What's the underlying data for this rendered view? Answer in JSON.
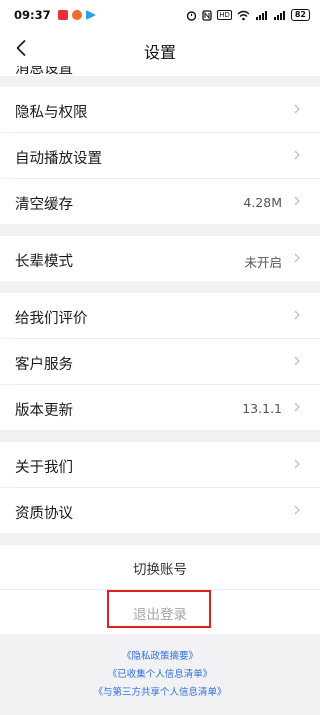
{
  "status_bar": {
    "time": "09:37",
    "app_colors": [
      "#e8303a",
      "#ef6c2d",
      "#2aa1e8"
    ],
    "indicators": [
      "alarm-icon",
      "nfc-icon",
      "hd-icon",
      "wifi-icon",
      "signal-icon",
      "signal-icon"
    ],
    "hd_text": "HD",
    "battery": "82"
  },
  "header": {
    "title": "设置",
    "back_icon": "chevron-left-icon"
  },
  "settings": {
    "clipped_label": "消息设置",
    "group1": [
      {
        "label": "隐私与权限",
        "value": ""
      },
      {
        "label": "自动播放设置",
        "value": ""
      },
      {
        "label": "清空缓存",
        "value": "4.28M"
      }
    ],
    "group2": [
      {
        "label": "长辈模式",
        "value": "未开启"
      }
    ],
    "group3": [
      {
        "label": "给我们评价",
        "value": ""
      },
      {
        "label": "客户服务",
        "value": ""
      },
      {
        "label": "版本更新",
        "value": "13.1.1"
      }
    ],
    "group4": [
      {
        "label": "关于我们",
        "value": ""
      },
      {
        "label": "资质协议",
        "value": ""
      }
    ]
  },
  "actions": {
    "switch_account": "切换账号",
    "logout": "退出登录",
    "highlight_color": "#e02020"
  },
  "links": [
    "《隐私政策摘要》",
    "《已收集个人信息清单》",
    "《与第三方共享个人信息清单》"
  ],
  "colors": {
    "link": "#2f6fe8",
    "page_bg": "#f2f2f4"
  }
}
